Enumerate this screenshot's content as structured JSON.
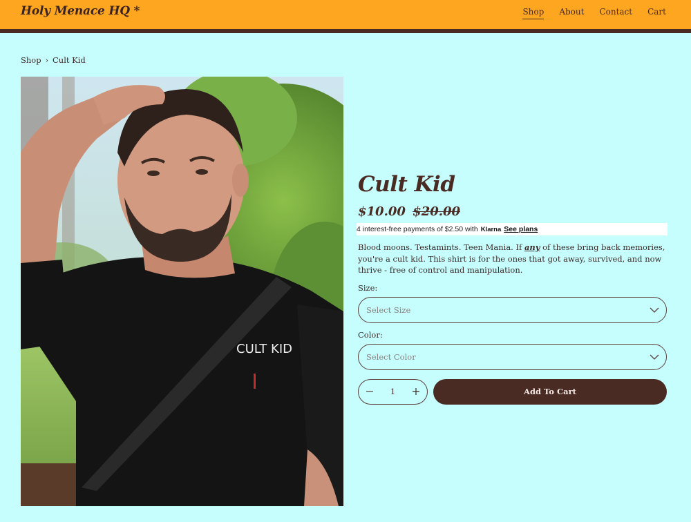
{
  "header": {
    "logo": "Holy Menace HQ *",
    "nav": [
      {
        "label": "Shop",
        "active": true
      },
      {
        "label": "About",
        "active": false
      },
      {
        "label": "Contact",
        "active": false
      },
      {
        "label": "Cart",
        "active": false
      }
    ]
  },
  "breadcrumb": {
    "root": "Shop",
    "separator": "›",
    "current": "Cult Kid"
  },
  "product": {
    "title": "Cult Kid",
    "price": "$10.00",
    "compare_price": "$20.00",
    "shirt_print": "CULT KID",
    "klarna": {
      "text": "4 interest-free payments of $2.50 with",
      "brand": "Klarna",
      "link": "See plans"
    },
    "description": {
      "before": "Blood moons. Testamints. Teen Mania. If ",
      "emphasis": "any",
      "after": " of these bring back memories, you're a cult kid. This shirt is for the ones that got away, survived, and now thrive - free of control and manipulation."
    },
    "size": {
      "label": "Size:",
      "placeholder": "Select Size"
    },
    "color": {
      "label": "Color:",
      "placeholder": "Select Color"
    },
    "quantity": "1",
    "add_to_cart": "Add To Cart"
  },
  "icons": {
    "decrease": "minus-icon",
    "increase": "plus-icon",
    "dropdown": "chevron-down-icon"
  },
  "colors": {
    "background": "#c6fdfd",
    "header": "#fea61f",
    "brand_dark": "#4a2b24",
    "klarna_bar": "#ffffff"
  }
}
